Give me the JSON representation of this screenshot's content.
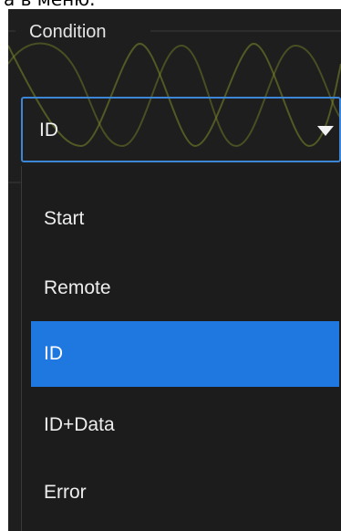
{
  "caption": {
    "text": "а в меню."
  },
  "condition": {
    "label": "Condition",
    "selected_value": "ID",
    "dropdown_icon": "caret-down-icon"
  },
  "menu": {
    "items": [
      {
        "label": "Start",
        "selected": false
      },
      {
        "label": "Remote",
        "selected": false
      },
      {
        "label": "ID",
        "selected": true
      },
      {
        "label": "ID+Data",
        "selected": false
      },
      {
        "label": "Error",
        "selected": false
      }
    ]
  },
  "colors": {
    "panel_background": "#1e1e1e",
    "accent": "#3b86d6",
    "selected_background": "#1f77e0",
    "text": "#ededed",
    "waveform": "#a7b63a"
  }
}
